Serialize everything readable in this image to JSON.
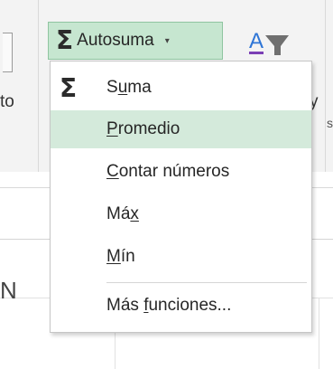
{
  "ribbon": {
    "autosum_button": {
      "sigma": "Σ",
      "label": "Autosuma",
      "caret": "▾"
    },
    "partial_left_text": "to",
    "partial_right_text": "y",
    "partial_right_text2": "s"
  },
  "grid": {
    "partial_column_letter": "N"
  },
  "menu": {
    "items": [
      {
        "icon": "Σ",
        "pre": "S",
        "key": "u",
        "post": "ma"
      },
      {
        "pre": "",
        "key": "P",
        "post": "romedio"
      },
      {
        "pre": "",
        "key": "C",
        "post": "ontar números"
      },
      {
        "pre": "Má",
        "key": "x",
        "post": ""
      },
      {
        "pre": "",
        "key": "M",
        "post": "ín"
      },
      {
        "pre": "Más ",
        "key": "f",
        "post": "unciones..."
      }
    ],
    "highlighted_index": 1,
    "highlight_color": "#d4eadb"
  },
  "colors": {
    "button_pressed_bg": "#c6e6d0",
    "ribbon_bg": "#f3f3f3"
  }
}
